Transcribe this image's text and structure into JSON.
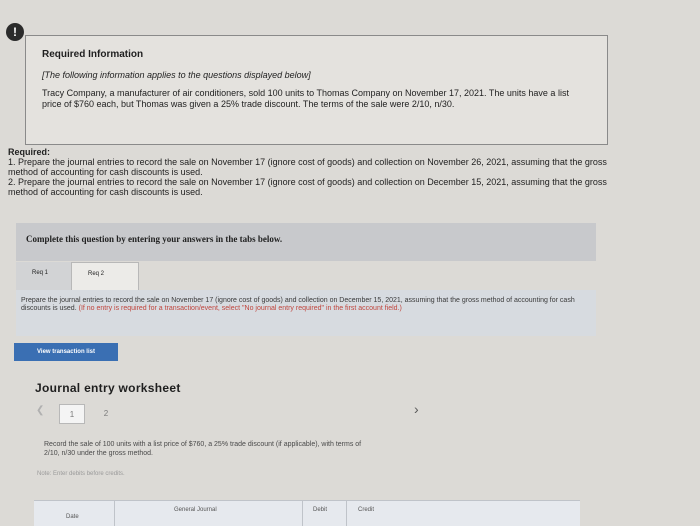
{
  "alert": {
    "symbol": "!"
  },
  "info": {
    "title": "Required Information",
    "subtitle": "[The following information applies to the questions displayed below]",
    "body": "Tracy Company, a manufacturer of air conditioners, sold 100 units to Thomas Company on November 17, 2021. The units have a list price of $760 each, but Thomas was given a 25% trade discount. The terms of the sale were 2/10, n/30."
  },
  "required": {
    "heading": "Required:",
    "item1": "1. Prepare the journal entries to record the sale on November 17 (ignore cost of goods) and collection on November 26, 2021, assuming that the gross method of accounting for cash discounts is used.",
    "item2": "2. Prepare the journal entries to record the sale on November 17 (ignore cost of goods) and collection on December 15, 2021, assuming that the gross method of accounting for cash discounts is used."
  },
  "complete_bar": "Complete this question by entering your answers in the tabs below.",
  "tabs": [
    {
      "label": "Req 1"
    },
    {
      "label": "Req 2"
    }
  ],
  "instructions": {
    "main": "Prepare the journal entries to record the sale on November 17 (ignore cost of goods) and collection on December 15, 2021, assuming that the gross method of accounting for cash discounts is used.",
    "note": "(If no entry is required for a transaction/event, select \"No journal entry required\" in the first account field.)"
  },
  "view_button": "View transaction list",
  "worksheet": {
    "title": "Journal entry worksheet",
    "pages": [
      "1",
      "2"
    ],
    "description": "Record the sale of 100 units with a list price of $760, a 25% trade discount (if applicable), with terms of 2/10, n/30 under the gross method.",
    "note": "Note: Enter debits before credits.",
    "columns": {
      "date": "Date",
      "general_journal": "General Journal",
      "debit": "Debit",
      "credit": "Credit"
    }
  }
}
